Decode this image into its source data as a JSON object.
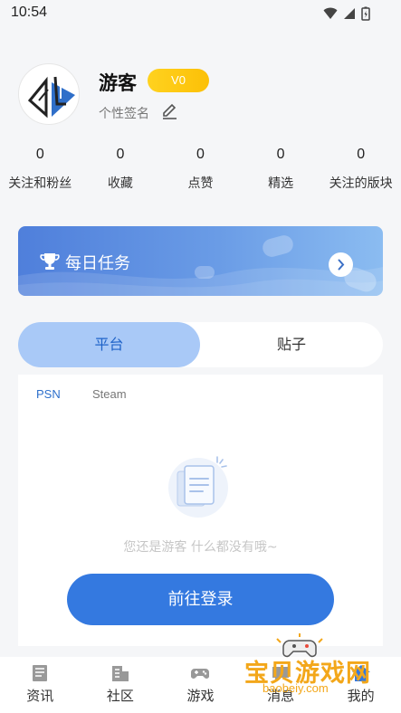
{
  "status_bar": {
    "time": "10:54"
  },
  "profile": {
    "username": "游客",
    "vip_level": "V0",
    "signature": "个性签名"
  },
  "stats": [
    {
      "value": "0",
      "label": "关注和粉丝"
    },
    {
      "value": "0",
      "label": "收藏"
    },
    {
      "value": "0",
      "label": "点赞"
    },
    {
      "value": "0",
      "label": "精选"
    },
    {
      "value": "0",
      "label": "关注的版块"
    }
  ],
  "daily_task": {
    "title": "每日任务"
  },
  "tabs": {
    "active": "平台",
    "inactive": "贴子"
  },
  "platform_tabs": {
    "psn": "PSN",
    "steam": "Steam"
  },
  "empty_state": {
    "message": "您还是游客 什么都没有哦~"
  },
  "login_button": {
    "label": "前往登录"
  },
  "bottom_nav": [
    {
      "label": "资讯",
      "icon": "news-icon"
    },
    {
      "label": "社区",
      "icon": "community-icon"
    },
    {
      "label": "游戏",
      "icon": "gamepad-icon"
    },
    {
      "label": "消息",
      "icon": "message-icon"
    },
    {
      "label": "我的",
      "icon": "profile-icon"
    }
  ],
  "watermark": {
    "text": "宝贝游戏网",
    "url": "baobeiy.com"
  },
  "colors": {
    "accent": "#3479e0",
    "vip": "#fcc007",
    "tab_active_bg": "#a9c9f7"
  }
}
